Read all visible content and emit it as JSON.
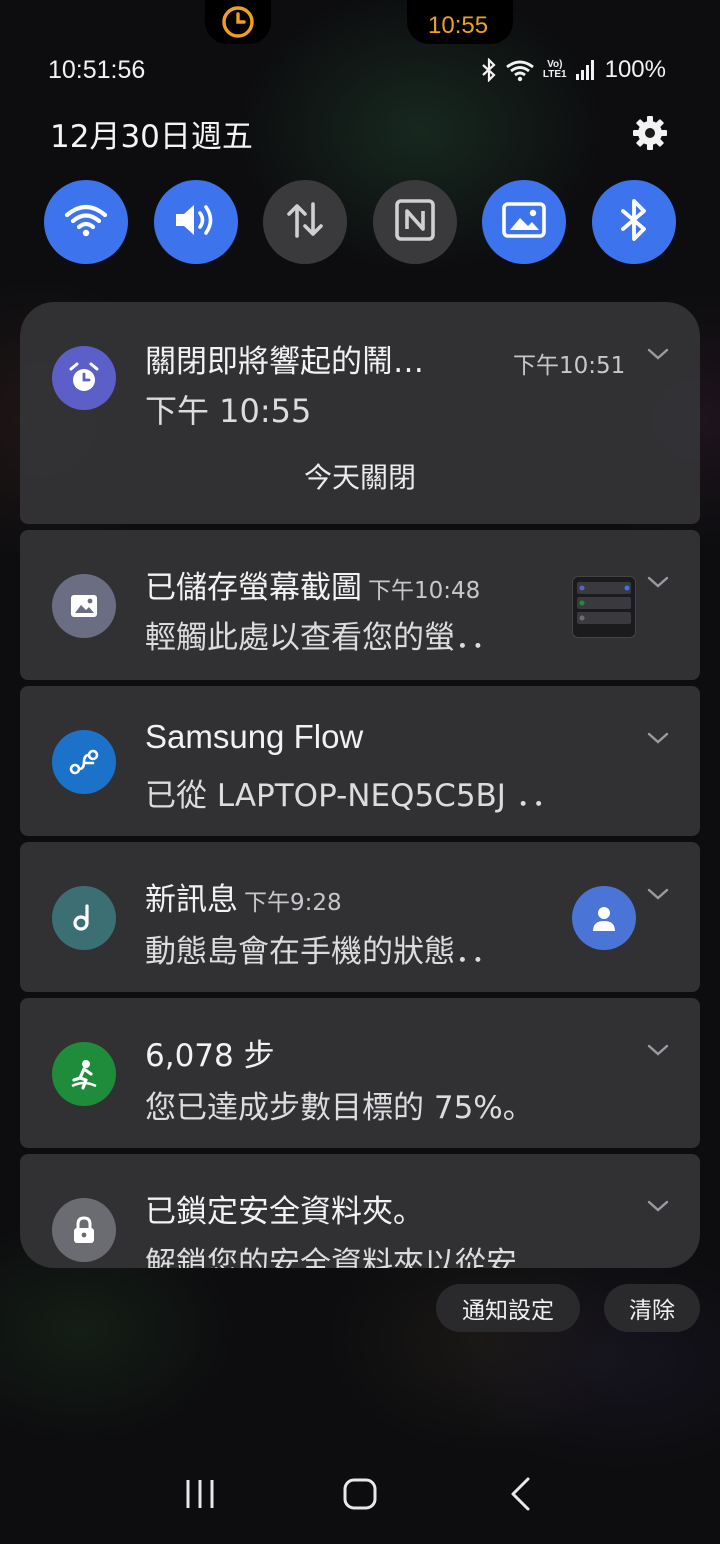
{
  "top_notch": {
    "time": "10:55",
    "alarm_icon": "alarm-clock-icon"
  },
  "status": {
    "clock": "10:51:56",
    "battery": "100%",
    "icons": [
      "bluetooth-icon",
      "wifi-icon",
      "volte-icon",
      "signal-icon"
    ]
  },
  "header": {
    "date": "12月30日週五",
    "settings_icon": "gear-icon"
  },
  "quick_settings": [
    {
      "name": "wifi",
      "icon": "wifi-icon",
      "state": "on"
    },
    {
      "name": "sound",
      "icon": "volume-icon",
      "state": "on"
    },
    {
      "name": "mobile-data",
      "icon": "data-arrows-icon",
      "state": "off"
    },
    {
      "name": "nfc",
      "icon": "nfc-icon",
      "state": "off"
    },
    {
      "name": "image",
      "icon": "image-icon",
      "state": "on"
    },
    {
      "name": "bluetooth",
      "icon": "bluetooth-icon",
      "state": "on"
    }
  ],
  "notifications": [
    {
      "id": "alarm",
      "title": "關閉即將響起的鬧…",
      "time": "下午10:51",
      "body": "下午 10:55",
      "action": "今天關閉",
      "icon": "alarm-icon",
      "icon_color": "#5b5fc7"
    },
    {
      "id": "screenshot",
      "title": "已儲存螢幕截圖",
      "time": "下午10:48",
      "body": "輕觸此處以查看您的螢．．",
      "icon": "image-icon",
      "icon_color": "#6b6e83"
    },
    {
      "id": "flow",
      "title": "Samsung Flow",
      "time": "",
      "body": "已從 LAPTOP-NEQ5C5BJ ．．",
      "icon": "flow-icon",
      "icon_color": "#1c72c9"
    },
    {
      "id": "message",
      "title": "新訊息",
      "time": "下午9:28",
      "body": "動態島會在手機的狀態．．",
      "icon": "music-note-icon",
      "icon_color": "#3b6f73"
    },
    {
      "id": "steps",
      "title": "6,078 步",
      "time": "",
      "body": "您已達成步數目標的 75%。",
      "icon": "walking-icon",
      "icon_color": "#1e8c3a"
    },
    {
      "id": "secure",
      "title": "已鎖定安全資料夾。",
      "time": "",
      "body": "解鎖您的安全資料夾以從安．．",
      "icon": "lock-icon",
      "icon_color": "#6b6b72"
    }
  ],
  "footer": {
    "settings_label": "通知設定",
    "clear_label": "清除"
  },
  "navbar": {
    "recent_icon": "recent-apps-icon",
    "home_icon": "home-icon",
    "back_icon": "back-icon"
  }
}
